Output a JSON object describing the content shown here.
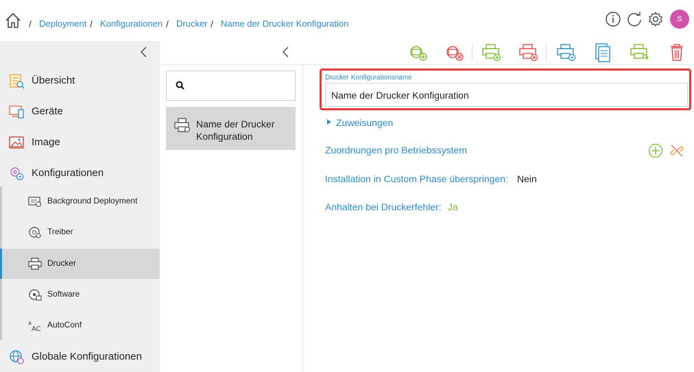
{
  "breadcrumb": {
    "items": [
      {
        "label": "Deployment"
      },
      {
        "label": "Konfigurationen"
      },
      {
        "label": "Drucker"
      },
      {
        "label": "Name der Drucker Konfiguration"
      }
    ],
    "separator": "/"
  },
  "header": {
    "icons": [
      "info-icon",
      "refresh-icon",
      "settings-icon"
    ],
    "avatar_initial": "S",
    "avatar_color": "#d253a9"
  },
  "sidebar": {
    "items": [
      {
        "label": "Übersicht",
        "icon": "overview-icon"
      },
      {
        "label": "Geräte",
        "icon": "devices-icon"
      },
      {
        "label": "Image",
        "icon": "image-icon"
      },
      {
        "label": "Konfigurationen",
        "icon": "configurations-icon"
      }
    ],
    "sub_items": [
      {
        "label": "Background Deployment",
        "icon": "background-deployment-icon"
      },
      {
        "label": "Treiber",
        "icon": "driver-icon"
      },
      {
        "label": "Drucker",
        "icon": "printer-icon",
        "active": true
      },
      {
        "label": "Software",
        "icon": "software-icon"
      },
      {
        "label": "AutoConf",
        "icon": "autoconf-icon"
      }
    ],
    "bottom_item": {
      "label": "Globale Konfigurationen",
      "icon": "global-config-icon"
    }
  },
  "list": {
    "search_placeholder": "",
    "items": [
      {
        "label": "Name der Drucker Konfiguration",
        "icon": "printer-config-icon"
      }
    ]
  },
  "toolbar": {
    "buttons": [
      "add-driver-icon",
      "remove-driver-icon",
      "add-printer-icon",
      "remove-printer-icon",
      "printer-settings-icon",
      "copy-icon",
      "export-icon",
      "delete-icon"
    ]
  },
  "detail": {
    "name_label": "Drucker Konfigurationsname",
    "name_value": "Name der Drucker Konfiguration",
    "assignments_label": "Zuweisungen",
    "os_mappings_label": "Zuordnungen pro Betriebssystem",
    "properties": [
      {
        "label": "Installation in Custom Phase überspringen:",
        "value": "Nein",
        "color": "#222222"
      },
      {
        "label": "Anhalten bei Druckerfehler:",
        "value": "Ja",
        "color": "#7cbb2a"
      }
    ]
  },
  "colors": {
    "accent": "#2a8bc9",
    "highlight_border": "#e23b3b",
    "green": "#7cbb2a",
    "red": "#e04a4a",
    "orange": "#f0a030"
  }
}
